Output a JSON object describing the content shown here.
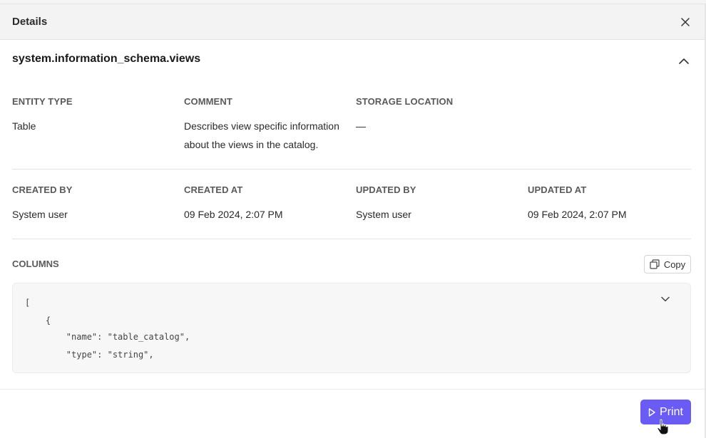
{
  "header": {
    "title": "Details"
  },
  "entity": {
    "name": "system.information_schema.views"
  },
  "details_row1": [
    {
      "label": "ENTITY TYPE",
      "value": "Table"
    },
    {
      "label": "COMMENT",
      "value": "Describes view specific information about the views in the catalog."
    },
    {
      "label": "STORAGE LOCATION",
      "value": "—"
    }
  ],
  "details_row2": [
    {
      "label": "CREATED BY",
      "value": "System user"
    },
    {
      "label": "CREATED AT",
      "value": "09 Feb 2024, 2:07 PM"
    },
    {
      "label": "UPDATED BY",
      "value": "System user"
    },
    {
      "label": "UPDATED AT",
      "value": "09 Feb 2024, 2:07 PM"
    }
  ],
  "columns": {
    "label": "COLUMNS",
    "copy_label": "Copy",
    "code_lines": [
      "[",
      "    {",
      "        \"name\": \"table_catalog\",",
      "        \"type\": \"string\","
    ]
  },
  "footer": {
    "print_label": "Print"
  },
  "colors": {
    "accent": "#6b5bf5",
    "header_bg": "#f3f3f3",
    "code_bg": "#f7f7f7"
  }
}
